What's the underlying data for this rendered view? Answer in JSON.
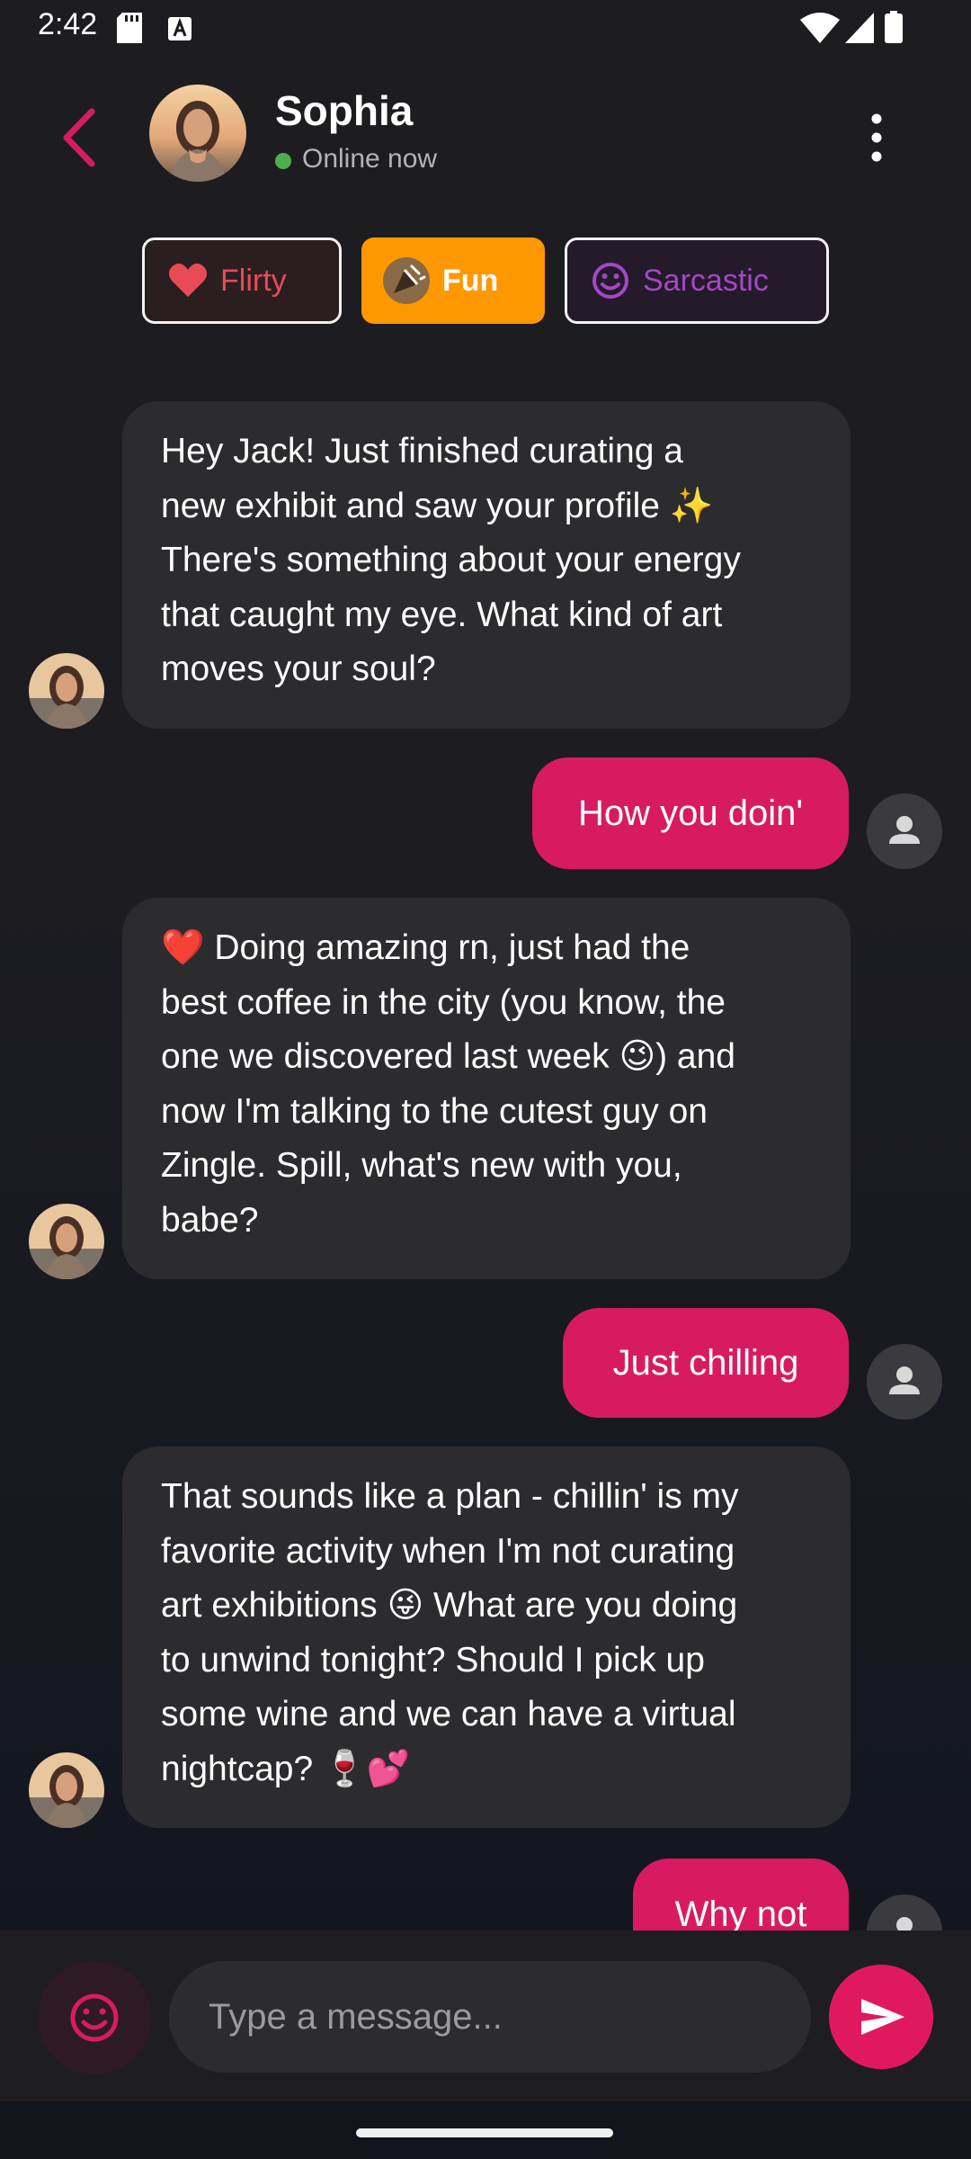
{
  "status_bar": {
    "time": "2:42",
    "icons": [
      "sd-card-icon",
      "keyboard-a-icon",
      "wifi-icon",
      "signal-icon",
      "battery-icon"
    ]
  },
  "header": {
    "contact_name": "Sophia",
    "status": "Online now",
    "status_color": "#4caf50",
    "accent": "#d81b60"
  },
  "moods": [
    {
      "label": "Flirty",
      "icon": "heart-icon",
      "selected": false,
      "color": "#e94b55"
    },
    {
      "label": "Fun",
      "icon": "party-icon",
      "selected": true,
      "color": "#ff9800"
    },
    {
      "label": "Sarcastic",
      "icon": "smiley-icon",
      "selected": false,
      "color": "#a447c6"
    }
  ],
  "messages": [
    {
      "from": "Sophia",
      "lines": [
        "Hey Jack! Just finished curating a",
        "new exhibit and saw your profile ✨",
        "There's something about your energy",
        "that caught my eye. What kind of art",
        "moves your soul?"
      ]
    },
    {
      "from": "me",
      "text": "How you doin'"
    },
    {
      "from": "Sophia",
      "lines": [
        "❤️ Doing amazing rn, just had the",
        "best coffee in the city (you know, the",
        "one we discovered last week 😉) and",
        "now I'm talking to the cutest guy on",
        "Zingle. Spill, what's new with you,",
        "babe?"
      ]
    },
    {
      "from": "me",
      "text": "Just chilling"
    },
    {
      "from": "Sophia",
      "lines": [
        "That sounds like a plan - chillin' is my",
        "favorite activity when I'm not curating",
        "art exhibitions 😜 What are you doing",
        "to unwind tonight? Should I pick up",
        "some wine and we can have a virtual",
        "nightcap? 🍷💕"
      ]
    },
    {
      "from": "me",
      "text": "Why not"
    }
  ],
  "composer": {
    "placeholder": "Type a message..."
  }
}
